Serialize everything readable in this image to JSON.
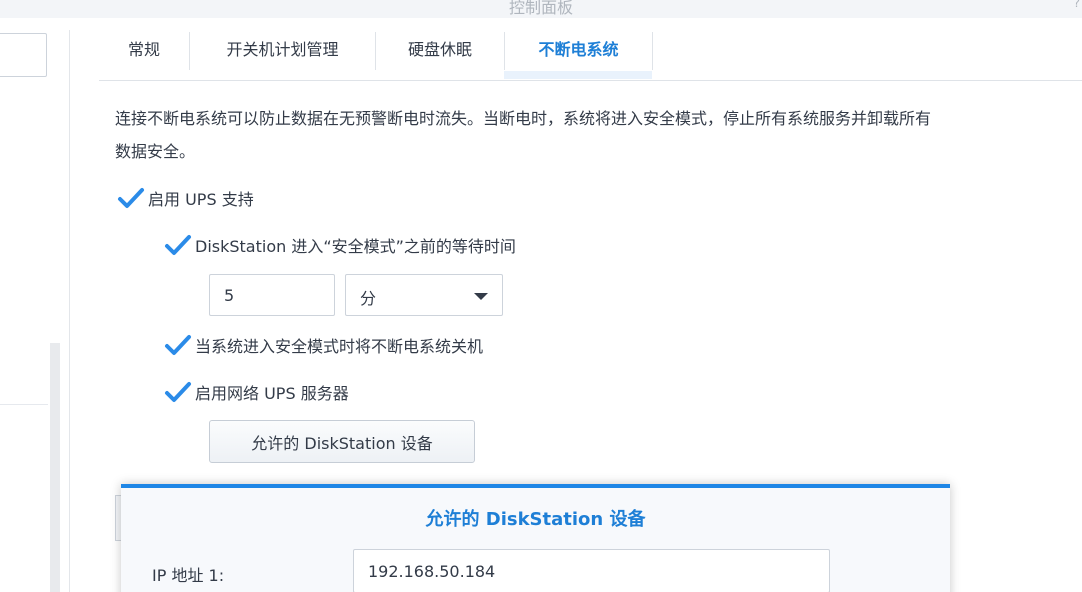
{
  "window": {
    "title": "控制面板",
    "corner_glyph": "?"
  },
  "tabs": [
    {
      "label": "常规",
      "active": false
    },
    {
      "label": "开关机计划管理",
      "active": false
    },
    {
      "label": "硬盘休眠",
      "active": false
    },
    {
      "label": "不断电系统",
      "active": true
    }
  ],
  "ups": {
    "description_line1": "连接不断电系统可以防止数据在无预警断电时流失。当断电时，系统将进入安全模式，停止所有系统服务并卸载所有",
    "description_line2": "数据安全。",
    "enable_ups": {
      "label": "启用 UPS 支持",
      "checked": true
    },
    "safe_mode_wait": {
      "label": "DiskStation 进入“安全模式”之前的等待时间",
      "checked": true
    },
    "wait_time_value": "5",
    "wait_time_unit": "分",
    "shutdown_ups": {
      "label": "当系统进入安全模式时将不断电系统关机",
      "checked": true
    },
    "network_ups_server": {
      "label": "启用网络 UPS 服务器",
      "checked": true
    },
    "allowed_devices_button": "允许的 DiskStation 设备"
  },
  "dialog": {
    "title": "允许的 DiskStation 设备",
    "ip_label": "IP 地址 1:",
    "ip_value": "192.168.50.184"
  },
  "colors": {
    "accent": "#1e7fd6",
    "check": "#2b8be8",
    "dialog_border": "#1e86e6"
  }
}
